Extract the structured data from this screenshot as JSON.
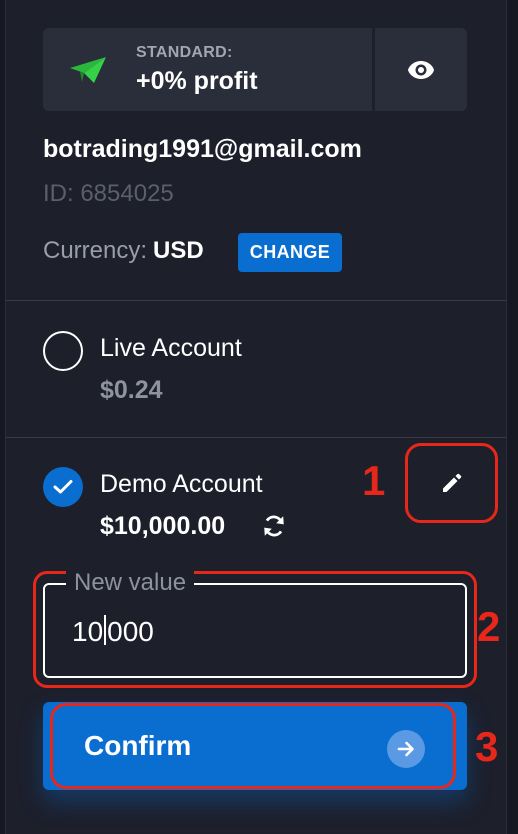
{
  "plan": {
    "tier": "STANDARD:",
    "profit": "+0% profit",
    "icon": "paper-plane-icon",
    "accent": "#2bb63c"
  },
  "account": {
    "email": "botrading1991@gmail.com",
    "id_label": "ID: 6854025",
    "currency_label": "Currency:",
    "currency_value": "USD",
    "change_label": "CHANGE"
  },
  "accounts": [
    {
      "name": "Live Account",
      "balance": "$0.24",
      "selected": false
    },
    {
      "name": "Demo Account",
      "balance": "$10,000.00",
      "selected": true
    }
  ],
  "edit_field": {
    "label": "New value",
    "value_before_caret": "10",
    "value_after_caret": "000"
  },
  "confirm": {
    "label": "Confirm"
  },
  "annotations": [
    "1",
    "2",
    "3"
  ],
  "colors": {
    "primary": "#0a6ed1",
    "annotation": "#e8271b",
    "panel": "#1d1f2b",
    "card": "#2a2d3a"
  }
}
